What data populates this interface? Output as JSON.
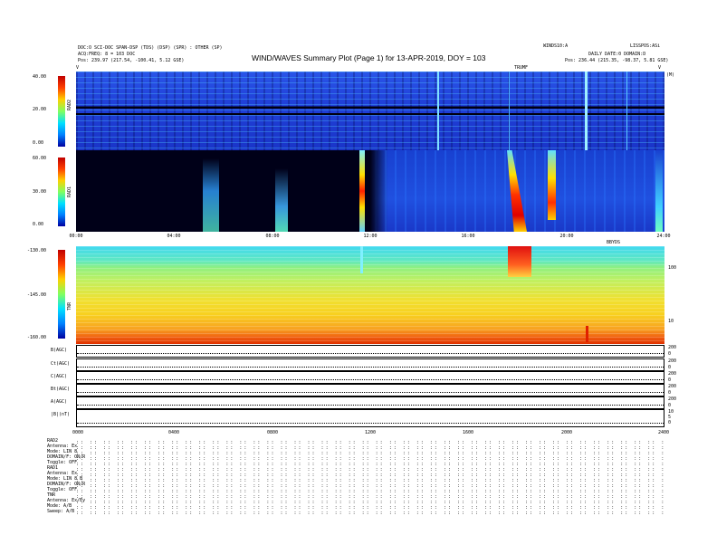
{
  "header": {
    "left_line1": "DOC:O SCI-DOC SPAN-DSP (TDS) (DSP) (SPR) : OTHER (SP)",
    "left_line2": "ACQ:FREQ: 8 = 103 DOC",
    "left_line3": "Pos:    239.97 (217.54, -100.41, 5.12 GSE)",
    "right_line1": "WINDS10:A",
    "right_line2": "LISSPOS:ASi",
    "right_line3": "DAILY  DATE:0 DOMAIN:D",
    "right_line4": "Pos:    236.44 (215.35, -98.37, 5.81 GSE)",
    "title": "WIND/WAVES Summary Plot (Page 1) for 13-APR-2019, DOY = 103",
    "marker_left": "V",
    "marker_mid": "TRUMF",
    "marker_right": "V",
    "marker_right2": "(M)"
  },
  "colors": {
    "bg_blue": "#1f3fd0",
    "dark": "#000018",
    "burst_red": "#e01010",
    "tnr_yellow": "#f0e020",
    "tnr_orange": "#f07010"
  },
  "rad2": {
    "label": "RAD2",
    "ticks": [
      "40.00",
      "20.00",
      "0.00"
    ]
  },
  "rad1": {
    "label": "RAD1",
    "ticks": [
      "60.00",
      "30.00",
      "0.00"
    ]
  },
  "tnr": {
    "label": "TNR",
    "ticks": [
      "-130.00",
      "-145.00",
      "-160.00"
    ],
    "right_ticks": [
      "100",
      "10"
    ],
    "right_header": "BBYDS"
  },
  "time_axis": [
    "00:00",
    "04:00",
    "08:00",
    "12:00",
    "16:00",
    "20:00",
    "24:00"
  ],
  "time_axis_small": [
    "0000",
    "0400",
    "0800",
    "1200",
    "1600",
    "2000",
    "2400"
  ],
  "line_panels": [
    {
      "label": "B(AGC)",
      "right": [
        "200",
        "0"
      ]
    },
    {
      "label": "Ct(AGC)",
      "right": [
        "200",
        "0"
      ]
    },
    {
      "label": "C(AGC)",
      "right": [
        "200",
        "0"
      ]
    },
    {
      "label": "Bt(AGC)",
      "right": [
        "200",
        "0"
      ]
    },
    {
      "label": "A(AGC)",
      "right": [
        "200",
        "0"
      ]
    },
    {
      "label": "|B|(nT)",
      "right": [
        "10",
        "5",
        "0"
      ]
    }
  ],
  "footer": {
    "rad2": [
      "RAD2",
      "Antenna:   Ex",
      "Mode:   LIN 8",
      "DOMAIN/F: ON/R",
      "Toggle:    OFF"
    ],
    "rad1": [
      "RAD1",
      "Antenna:   Ex",
      "Mode:   LIN 8 B",
      "DOMAIN/F: ON/R",
      "Toggle:    OFF"
    ],
    "tnr": [
      "TNR",
      "Antenna:  Ex/Ey",
      "Mode:      A/B",
      "Sweep:     A/B"
    ],
    "dots": ":: :: :: :: :: :: :: :: :: :: :: :: :: :: :: :: :: :: :: :: :: :: :: :: :: :: :: :: :: :: :: :: :: :: :: :: :: :: :: :: :: :: :: :: :: :: :: :: :: :: :: :: :: :: :: :: ::"
  }
}
